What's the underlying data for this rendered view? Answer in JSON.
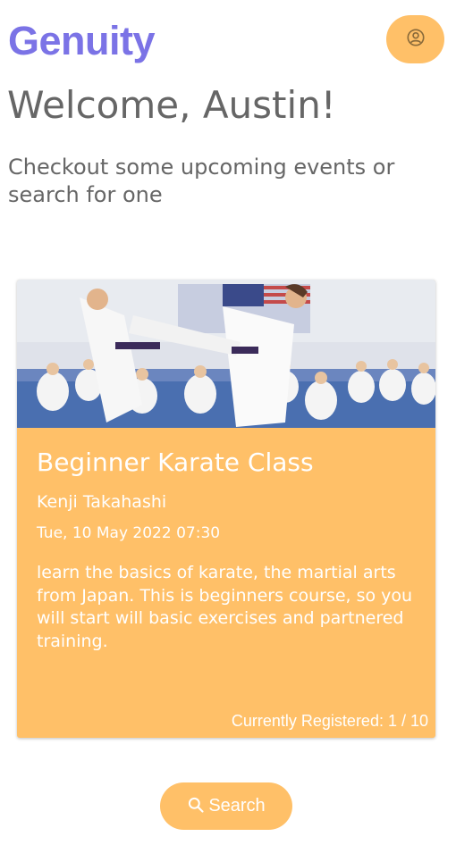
{
  "header": {
    "brand": "Genuity",
    "profile_icon": "account-circle-icon"
  },
  "greeting": {
    "title": "Welcome, Austin!",
    "subtitle": "Checkout some upcoming events or search for one"
  },
  "event": {
    "image_icon": "karate-class-photo",
    "title": "Beginner Karate Class",
    "instructor": "Kenji Takahashi",
    "datetime": "Tue, 10 May 2022 07:30",
    "description": "learn the basics of karate, the martial arts from Japan. This is beginners course, so you will start will basic exercises and partnered training.",
    "registered": "Currently Registered: 1 / 10"
  },
  "search": {
    "label": "Search",
    "icon": "search-icon"
  },
  "colors": {
    "brand": "#7b73e6",
    "accent": "#ffc068",
    "text": "#666666"
  }
}
